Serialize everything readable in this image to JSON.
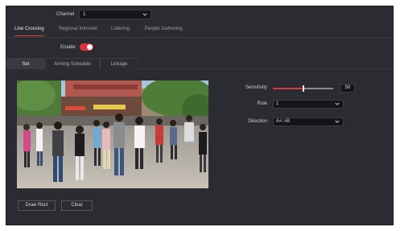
{
  "channel": {
    "label": "Channel",
    "value": "1"
  },
  "tabs": [
    {
      "label": "Line Crossing",
      "active": true
    },
    {
      "label": "Regional Intrusion",
      "active": false
    },
    {
      "label": "Loitering",
      "active": false
    },
    {
      "label": "People Gathering",
      "active": false
    }
  ],
  "enable": {
    "label": "Enable",
    "on": true
  },
  "subtabs": [
    {
      "label": "Set",
      "active": true
    },
    {
      "label": "Arming Schedule",
      "active": false
    },
    {
      "label": "Linkage",
      "active": false
    }
  ],
  "sensitivity": {
    "label": "Sensitivity",
    "value": "50",
    "level": 0.5
  },
  "rule": {
    "label": "Rule",
    "value": "1"
  },
  "direction": {
    "label": "Direction",
    "value": "A<->B"
  },
  "buttons": {
    "draw_rect": "Draw Rect",
    "clear": "Clear"
  },
  "colors": {
    "accent": "#e1303b",
    "background": "#2b2c31",
    "field": "#141518"
  }
}
